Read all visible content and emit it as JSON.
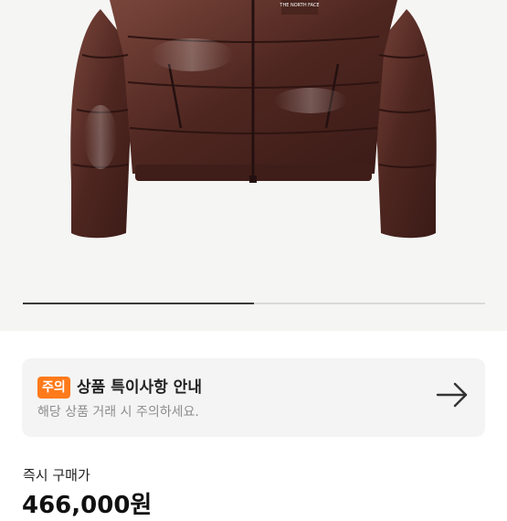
{
  "product": {
    "image_alt": "brown puffer jacket",
    "brand_mark": "THE NORTH FACE",
    "gallery_progress": 0.5
  },
  "notice": {
    "badge": "주의",
    "title": "상품 특이사항 안내",
    "subtitle": "해당 상품 거래 시 주의하세요.",
    "arrow_icon": "arrow-right-icon"
  },
  "purchase": {
    "label": "즉시 구매가",
    "price": "466,000원"
  },
  "colors": {
    "badge": "#ff7a1a",
    "jacket": "#5a2e26"
  }
}
